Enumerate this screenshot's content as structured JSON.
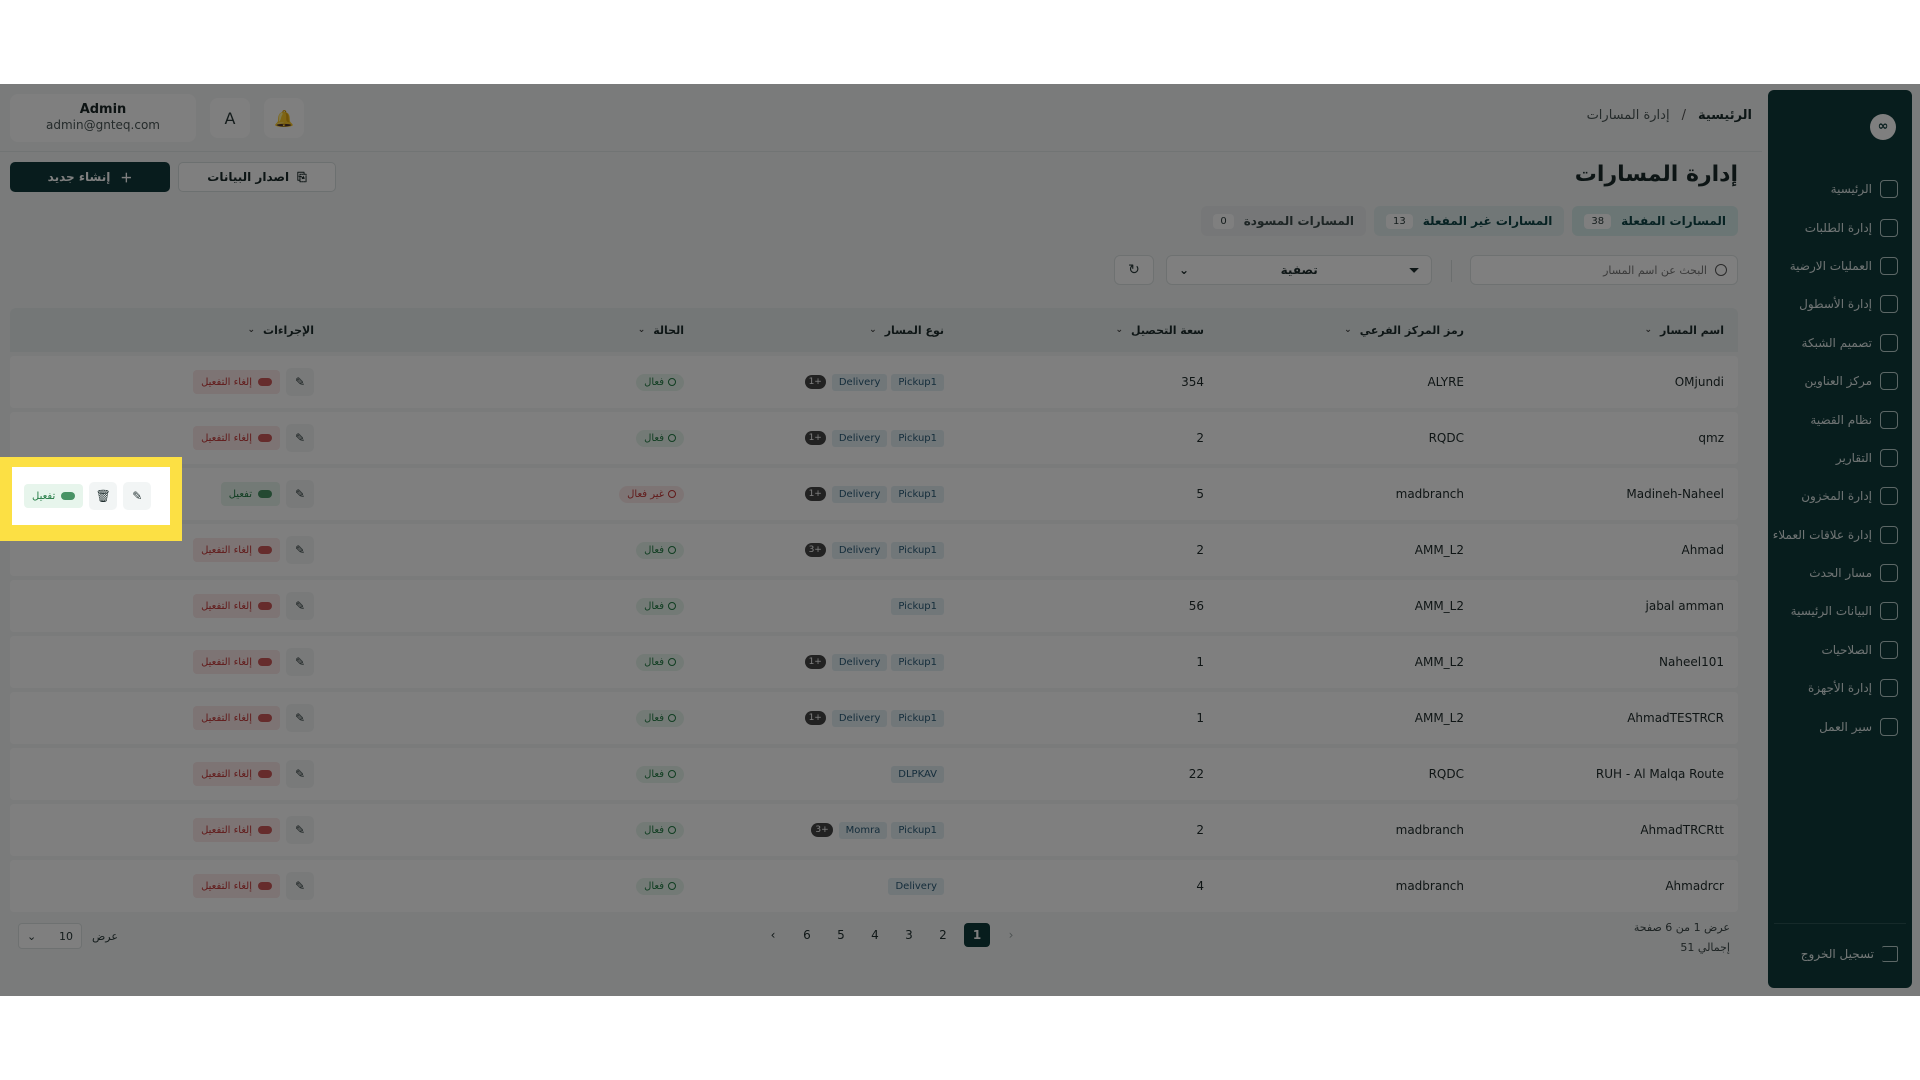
{
  "user": {
    "name": "Admin",
    "email": "admin@gnteq.com"
  },
  "topbar": {
    "translate_icon": "A",
    "bell_icon": "bell-icon"
  },
  "breadcrumb": {
    "home": "الرئيسية",
    "separator": "/",
    "current": "إدارة المسارات"
  },
  "page": {
    "title": "إدارة المسارات",
    "create_label": "إنشاء جديد",
    "export_label": "اصدار البيانات"
  },
  "tabs": [
    {
      "label": "المسارات المفعلة",
      "count": "38"
    },
    {
      "label": "المسارات غير المفعلة",
      "count": "13"
    },
    {
      "label": "المسارات المسودة",
      "count": "0"
    }
  ],
  "search": {
    "placeholder": "البحث عن اسم المسار"
  },
  "filter": {
    "label": "تصفية"
  },
  "table": {
    "headers": {
      "name": "اسم المسار",
      "code": "رمز المركز الفرعي",
      "capacity": "سعة التحصيل",
      "type": "نوع المسار",
      "status": "الحالة",
      "actions": "الإجراءات"
    },
    "rows": [
      {
        "name": "OMjundi",
        "code": "ALYRE",
        "capacity": "354",
        "tags": [
          "Pickup1",
          "Delivery"
        ],
        "more": "1+",
        "status": "فعال",
        "action": "إلغاء التفعيل"
      },
      {
        "name": "qmz",
        "code": "RQDC",
        "capacity": "2",
        "tags": [
          "Pickup1",
          "Delivery"
        ],
        "more": "1+",
        "status": "فعال",
        "action": "إلغاء التفعيل"
      },
      {
        "name": "Madineh-Naheel",
        "code": "madbranch",
        "capacity": "5",
        "tags": [
          "Pickup1",
          "Delivery"
        ],
        "more": "1+",
        "status": "غير فعال",
        "action": "تفعيل"
      },
      {
        "name": "Ahmad",
        "code": "AMM_L2",
        "capacity": "2",
        "tags": [
          "Pickup1",
          "Delivery"
        ],
        "more": "3+",
        "status": "فعال",
        "action": "إلغاء التفعيل"
      },
      {
        "name": "jabal amman",
        "code": "AMM_L2",
        "capacity": "56",
        "tags": [
          "Pickup1"
        ],
        "more": "",
        "status": "فعال",
        "action": "إلغاء التفعيل"
      },
      {
        "name": "Naheel101",
        "code": "AMM_L2",
        "capacity": "1",
        "tags": [
          "Pickup1",
          "Delivery"
        ],
        "more": "1+",
        "status": "فعال",
        "action": "إلغاء التفعيل"
      },
      {
        "name": "AhmadTESTRCR",
        "code": "AMM_L2",
        "capacity": "1",
        "tags": [
          "Pickup1",
          "Delivery"
        ],
        "more": "1+",
        "status": "فعال",
        "action": "إلغاء التفعيل"
      },
      {
        "name": "RUH - Al Malqa Route",
        "code": "RQDC",
        "capacity": "22",
        "tags": [
          "DLPKAV"
        ],
        "more": "",
        "status": "فعال",
        "action": "إلغاء التفعيل"
      },
      {
        "name": "AhmadTRCRtt",
        "code": "madbranch",
        "capacity": "2",
        "tags": [
          "Pickup1",
          "Momra"
        ],
        "more": "3+",
        "status": "فعال",
        "action": "إلغاء التفعيل"
      },
      {
        "name": "Ahmadrcr",
        "code": "madbranch",
        "capacity": "4",
        "tags": [
          "Delivery"
        ],
        "more": "",
        "status": "فعال",
        "action": "إلغاء التفعيل"
      }
    ]
  },
  "pagination": {
    "info_line1": "عرض 1 من 6 صفحة",
    "info_line2": "إجمالي 51",
    "pages": [
      "1",
      "2",
      "3",
      "4",
      "5",
      "6"
    ],
    "current": "1",
    "per_page_label": "عرض",
    "per_page_value": "10"
  },
  "sidebar": {
    "items": [
      "الرئيسية",
      "إدارة الطلبات",
      "العمليات الارضية",
      "إدارة الأسطول",
      "تصميم الشبكة",
      "مركز العناوين",
      "نظام القضية",
      "التقارير",
      "إدارة المخزون",
      "إدارة علاقات العملاء",
      "مسار الحدث",
      "البيانات الرئيسية",
      "الصلاحيات",
      "إدارة الأجهزة",
      "سير العمل"
    ],
    "logout": "تسجيل الخروج"
  },
  "highlight": {
    "activate_label": "تفعيل"
  },
  "colors": {
    "primary": "#0f3a3a",
    "highlight": "#fce044",
    "active_green": "#217a43",
    "inactive_red": "#c23434"
  }
}
